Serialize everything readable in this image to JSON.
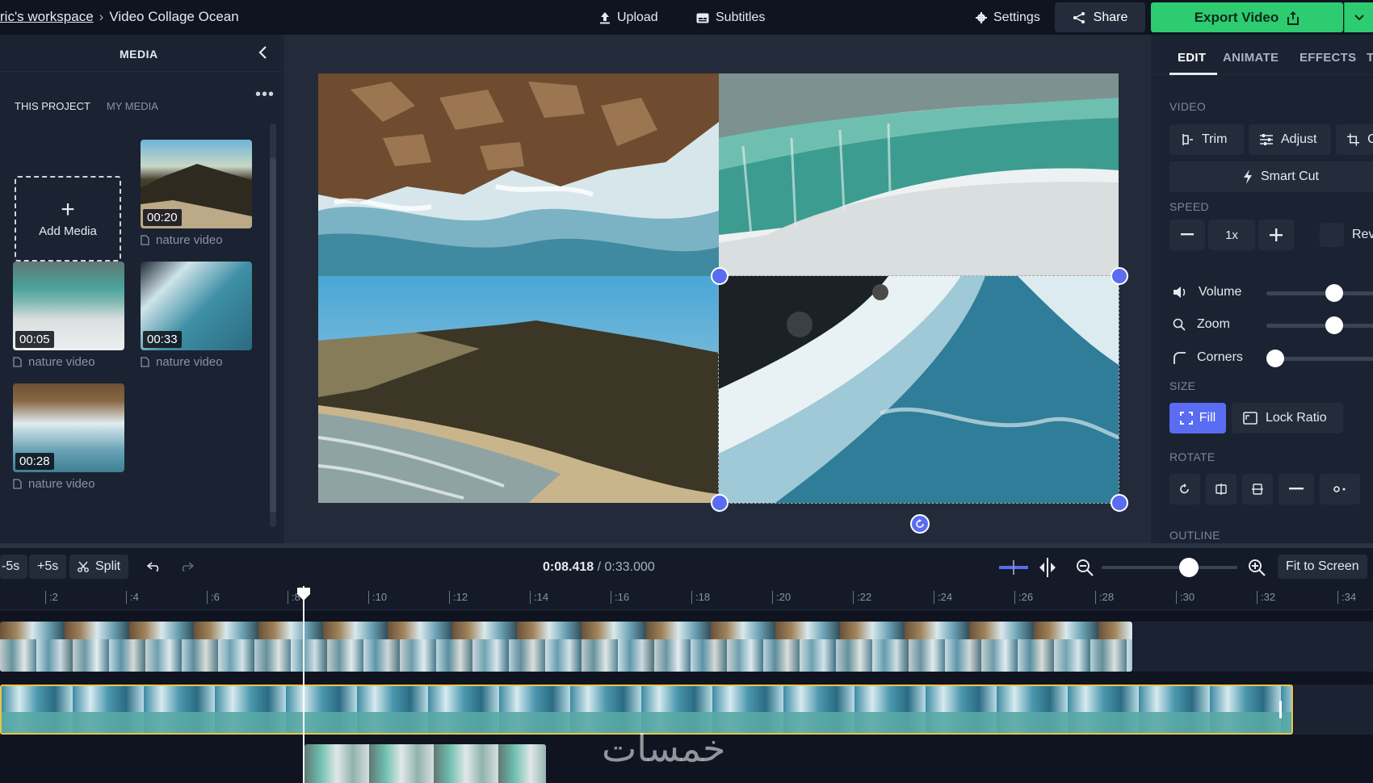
{
  "header": {
    "workspace": "ric's workspace",
    "separator": "›",
    "project_title": "Video Collage Ocean",
    "upload_label": "Upload",
    "subtitles_label": "Subtitles",
    "settings_label": "Settings",
    "share_label": "Share",
    "export_label": "Export Video"
  },
  "media": {
    "title": "MEDIA",
    "tabs": [
      "THIS PROJECT",
      "MY MEDIA"
    ],
    "more": "•••",
    "add_media_label": "Add Media",
    "items": [
      {
        "duration": "00:20",
        "label": "nature video"
      },
      {
        "duration": "00:05",
        "label": "nature video"
      },
      {
        "duration": "00:33",
        "label": "nature video"
      },
      {
        "duration": "00:28",
        "label": "nature video"
      }
    ]
  },
  "inspector": {
    "tabs": [
      "EDIT",
      "ANIMATE",
      "EFFECTS",
      "T"
    ],
    "video_section": "VIDEO",
    "trim_label": "Trim",
    "adjust_label": "Adjust",
    "crop_label": "Cr",
    "smart_cut_label": "Smart Cut",
    "speed_section": "SPEED",
    "speed_value": "1x",
    "reverse_label": "Rev",
    "volume_label": "Volume",
    "zoom_label": "Zoom",
    "corners_label": "Corners",
    "volume_level": 0.75,
    "zoom_level": 0.75,
    "corners_level": 0.0,
    "size_section": "SIZE",
    "fill_label": "Fill",
    "lock_ratio_label": "Lock Ratio",
    "rotate_section": "ROTATE",
    "outline_section": "OUTLINE"
  },
  "timeline": {
    "minus5": "-5s",
    "plus5": "+5s",
    "split_label": "Split",
    "current_time": "0:08.418",
    "total_time": "0:33.000",
    "time_sep": " / ",
    "fit_label": "Fit to Screen",
    "ruler": [
      ":2",
      ":4",
      ":6",
      ":8",
      ":10",
      ":12",
      ":14",
      ":16",
      ":18",
      ":20",
      ":22",
      ":24",
      ":26",
      ":28",
      ":30",
      ":32",
      ":34"
    ]
  },
  "watermark": "خمسات",
  "colors": {
    "accent": "#5a6cf2",
    "export": "#2ecc71",
    "selected_track": "#e8c34a"
  }
}
